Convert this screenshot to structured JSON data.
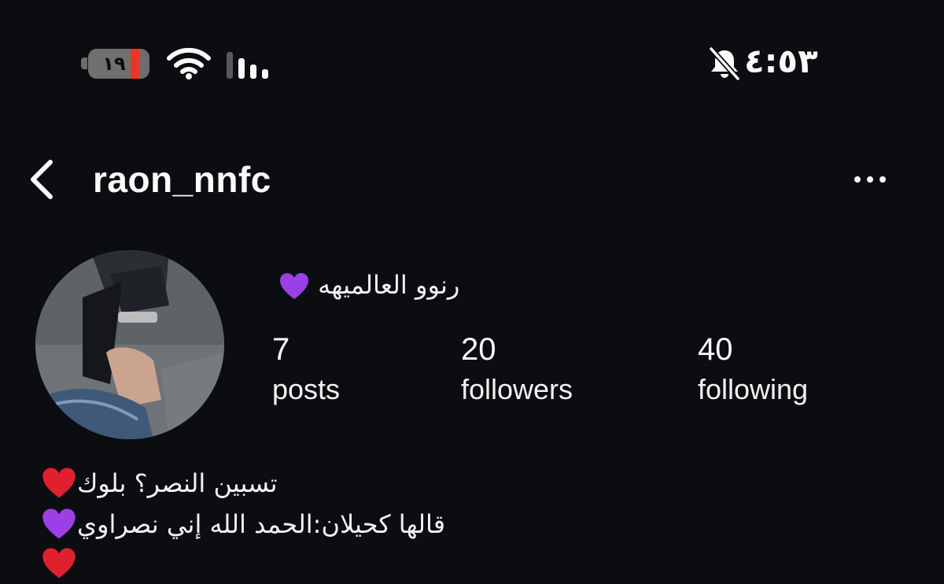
{
  "status_bar": {
    "battery_level": "١٩",
    "time": "٤:٥٣",
    "icons": [
      "battery-icon",
      "wifi-icon",
      "cellular-signal-icon",
      "bell-muted-icon"
    ],
    "colors": {
      "battery_low": "#e8362d"
    }
  },
  "header": {
    "username": "raon_nnfc",
    "back_icon": "chevron-left-icon",
    "more_icon": "more-horizontal-icon"
  },
  "profile": {
    "display_name": "رنوو العالميهه",
    "display_name_emoji": "purple-heart",
    "stats": [
      {
        "value": "7",
        "label": "posts"
      },
      {
        "value": "20",
        "label": "followers"
      },
      {
        "value": "40",
        "label": "following"
      }
    ],
    "bio": [
      {
        "text": "تسبين النصر؟ بلوك",
        "emoji": "red-heart"
      },
      {
        "text": "قالها كحيلان:الحمد الله إني نصراوي",
        "emoji": "purple-heart"
      },
      {
        "text": "",
        "emoji": "red-heart"
      }
    ]
  },
  "colors": {
    "background": "#0c0d11",
    "text": "#f2f2f2",
    "red_heart": "#e0202e",
    "purple_heart": "#9b3fe6"
  }
}
